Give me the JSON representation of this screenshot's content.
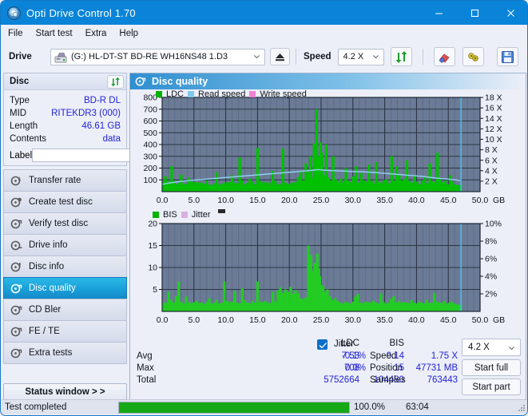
{
  "window": {
    "title": "Opti Drive Control 1.70",
    "icon": "disc-icon",
    "minimize": "minimize-icon",
    "maximize": "maximize-icon",
    "close": "close-icon"
  },
  "menu": {
    "items": [
      "File",
      "Start test",
      "Extra",
      "Help"
    ]
  },
  "toolbar": {
    "drive_label": "Drive",
    "drive_value": "(G:)  HL-DT-ST BD-RE  WH16NS48 1.D3",
    "eject_icon": "eject-icon",
    "speed_label": "Speed",
    "speed_value": "4.2 X",
    "refresh_icon": "refresh-icon",
    "eraser_icon": "eraser-icon",
    "settings_icon": "gear-icon",
    "save_icon": "save-icon"
  },
  "disc": {
    "header": "Disc",
    "refresh_icon": "refresh-icon",
    "rows": [
      {
        "key": "Type",
        "value": "BD-R DL"
      },
      {
        "key": "MID",
        "value": "RITEKDR3 (000)"
      },
      {
        "key": "Length",
        "value": "46.61 GB"
      },
      {
        "key": "Contents",
        "value": "data"
      }
    ],
    "label_key": "Label",
    "label_value": "",
    "label_placeholder": "",
    "cd_icon": "cd-icon"
  },
  "nav": {
    "items": [
      {
        "label": "Transfer rate",
        "icon": "disc-rate-icon",
        "selected": false
      },
      {
        "label": "Create test disc",
        "icon": "disc-create-icon",
        "selected": false
      },
      {
        "label": "Verify test disc",
        "icon": "disc-verify-icon",
        "selected": false
      },
      {
        "label": "Drive info",
        "icon": "disc-drive-icon",
        "selected": false
      },
      {
        "label": "Disc info",
        "icon": "disc-info-icon",
        "selected": false
      },
      {
        "label": "Disc quality",
        "icon": "disc-quality-icon",
        "selected": true
      },
      {
        "label": "CD Bler",
        "icon": "disc-bler-icon",
        "selected": false
      },
      {
        "label": "FE / TE",
        "icon": "disc-fete-icon",
        "selected": false
      },
      {
        "label": "Extra tests",
        "icon": "disc-extra-icon",
        "selected": false
      }
    ],
    "status_window": "Status window > >"
  },
  "panel": {
    "title": "Disc quality",
    "icon": "disc-quality-icon"
  },
  "chart_data": [
    {
      "type": "area",
      "name": "ldc-chart",
      "title": "",
      "xlabel": "GB",
      "ylabel": "",
      "xlim": [
        0,
        50
      ],
      "ylim": [
        0,
        800
      ],
      "y2lim": [
        0,
        18
      ],
      "xticks": [
        "0.0",
        "5.0",
        "10.0",
        "15.0",
        "20.0",
        "25.0",
        "30.0",
        "35.0",
        "40.0",
        "45.0",
        "50.0"
      ],
      "yticks": [
        "100",
        "200",
        "300",
        "400",
        "500",
        "600",
        "700",
        "800"
      ],
      "y2ticks": [
        "2 X",
        "4 X",
        "6 X",
        "8 X",
        "10 X",
        "12 X",
        "14 X",
        "16 X",
        "18 X"
      ],
      "x_unit": "GB",
      "grid": true,
      "legend": [
        {
          "label": "LDC",
          "color": "#00b300"
        },
        {
          "label": "Read speed",
          "color": "#7ec8ef"
        },
        {
          "label": "Write speed",
          "color": "#ee82d6"
        }
      ],
      "series": [
        {
          "name": "LDC",
          "color": "#00c000",
          "kind": "spikes",
          "x": [
            0.2,
            0.5,
            0.8,
            1.1,
            1.5,
            1.9,
            2.2,
            2.6,
            3.0,
            3.4,
            3.8,
            4.2,
            4.6,
            5.0,
            5.4,
            5.8,
            6.2,
            6.6,
            7.0,
            7.4,
            7.8,
            8.2,
            8.6,
            9.0,
            9.4,
            9.8,
            10.2,
            10.6,
            11.0,
            11.4,
            11.8,
            12.2,
            12.6,
            13.0,
            13.4,
            13.8,
            14.2,
            14.6,
            15.0,
            15.4,
            15.8,
            16.2,
            16.6,
            17.0,
            17.4,
            17.8,
            18.2,
            18.6,
            19.0,
            19.4,
            19.8,
            20.2,
            20.6,
            21.0,
            21.4,
            21.8,
            22.2,
            22.6,
            23.0,
            23.3,
            23.6,
            23.9,
            24.1,
            24.3,
            24.5,
            24.7,
            24.9,
            25.1,
            25.3,
            25.5,
            25.8,
            26.1,
            26.5,
            26.9,
            27.3,
            27.7,
            28.1,
            28.5,
            28.9,
            29.3,
            29.7,
            30.1,
            30.5,
            30.9,
            31.3,
            31.7,
            32.1,
            32.5,
            32.9,
            33.3,
            33.7,
            34.1,
            34.5,
            34.9,
            35.3,
            35.7,
            36.1,
            36.5,
            36.9,
            37.3,
            37.7,
            38.1,
            38.5,
            38.9,
            39.3,
            39.7,
            40.1,
            40.5,
            40.9,
            41.3,
            41.7,
            42.1,
            42.5,
            42.9,
            43.3,
            43.7,
            44.1,
            44.5,
            44.9,
            45.3,
            45.7,
            46.1,
            46.5,
            46.9
          ],
          "y": [
            80,
            130,
            95,
            70,
            215,
            90,
            60,
            75,
            145,
            65,
            60,
            120,
            85,
            55,
            60,
            80,
            60,
            65,
            95,
            60,
            55,
            70,
            165,
            60,
            55,
            65,
            80,
            60,
            140,
            70,
            60,
            290,
            95,
            60,
            75,
            110,
            85,
            60,
            370,
            90,
            60,
            70,
            60,
            55,
            175,
            90,
            60,
            65,
            365,
            75,
            60,
            70,
            80,
            60,
            125,
            170,
            95,
            240,
            160,
            300,
            120,
            410,
            240,
            700,
            300,
            175,
            420,
            330,
            115,
            140,
            400,
            120,
            95,
            300,
            105,
            80,
            110,
            85,
            200,
            95,
            80,
            130,
            215,
            75,
            160,
            95,
            80,
            230,
            95,
            60,
            250,
            85,
            75,
            100,
            105,
            70,
            300,
            90,
            215,
            140,
            95,
            105,
            265,
            90,
            75,
            140,
            85,
            60,
            95,
            120,
            70,
            240,
            90,
            70,
            330,
            105,
            80,
            95,
            60,
            140,
            85,
            60,
            55,
            50
          ]
        },
        {
          "name": "Read speed",
          "color": "#8fd3f5",
          "kind": "line",
          "x": [
            0.0,
            2.0,
            4.0,
            6.0,
            8.0,
            10.0,
            12.0,
            14.0,
            16.0,
            18.0,
            20.0,
            22.0,
            23.8,
            24.5,
            25.5,
            27.0,
            29.0,
            31.0,
            33.0,
            35.0,
            37.0,
            39.0,
            41.0,
            43.0,
            45.0,
            46.5,
            47.0
          ],
          "y_x": [
            1.4,
            1.8,
            2.1,
            2.3,
            2.5,
            2.7,
            2.9,
            3.1,
            3.3,
            3.5,
            3.7,
            3.9,
            4.1,
            4.2,
            4.1,
            4.0,
            3.9,
            3.8,
            3.7,
            3.5,
            3.3,
            3.1,
            2.9,
            2.6,
            2.4,
            2.2,
            2.1
          ]
        }
      ],
      "cursor_x": 47.0,
      "cursor_color": "#4fc3f7"
    },
    {
      "type": "area",
      "name": "bis-chart",
      "title": "",
      "xlabel": "GB",
      "ylabel": "",
      "xlim": [
        0,
        50
      ],
      "ylim": [
        0,
        20
      ],
      "y2lim": [
        0,
        10
      ],
      "xticks": [
        "0.0",
        "5.0",
        "10.0",
        "15.0",
        "20.0",
        "25.0",
        "30.0",
        "35.0",
        "40.0",
        "45.0",
        "50.0"
      ],
      "yticks": [
        "5",
        "10",
        "15",
        "20"
      ],
      "y2ticks": [
        "2%",
        "4%",
        "6%",
        "8%",
        "10%"
      ],
      "x_unit": "GB",
      "grid": true,
      "legend": [
        {
          "label": "BIS",
          "color": "#00b300"
        },
        {
          "label": "Jitter",
          "color": "#d8b0e0"
        }
      ],
      "series": [
        {
          "name": "BIS",
          "color": "#22cc22",
          "kind": "spikes",
          "x": [
            0.2,
            0.6,
            1.0,
            1.4,
            1.8,
            2.2,
            2.6,
            3.0,
            3.4,
            3.8,
            4.2,
            4.6,
            5.0,
            5.4,
            5.8,
            6.2,
            6.6,
            7.0,
            7.4,
            7.8,
            8.2,
            8.6,
            9.0,
            9.4,
            9.8,
            10.2,
            10.6,
            11.0,
            11.4,
            11.8,
            12.2,
            12.6,
            13.0,
            13.4,
            13.8,
            14.2,
            14.6,
            15.0,
            15.4,
            15.8,
            16.2,
            16.6,
            17.0,
            17.4,
            17.8,
            18.2,
            18.6,
            19.0,
            19.4,
            19.8,
            20.2,
            20.6,
            21.0,
            21.4,
            21.8,
            22.2,
            22.6,
            23.0,
            23.4,
            23.7,
            24.0,
            24.2,
            24.4,
            24.6,
            24.8,
            25.0,
            25.3,
            25.6,
            26.0,
            26.4,
            26.8,
            27.2,
            27.6,
            28.0,
            28.4,
            28.8,
            29.2,
            29.6,
            30.0,
            30.4,
            30.8,
            31.2,
            31.6,
            32.0,
            32.4,
            32.8,
            33.2,
            33.6,
            34.0,
            34.4,
            34.8,
            35.2,
            35.6,
            36.0,
            36.4,
            36.8,
            37.2,
            37.6,
            38.0,
            38.4,
            38.8,
            39.2,
            39.6,
            40.0,
            40.4,
            40.8,
            41.2,
            41.6,
            42.0,
            42.4,
            42.8,
            43.2,
            43.6,
            44.0,
            44.4,
            44.8,
            45.2,
            45.6,
            46.0,
            46.4,
            46.8
          ],
          "y": [
            1.7,
            2.0,
            4.5,
            2.6,
            2.0,
            3.5,
            6.8,
            2.2,
            1.8,
            3.4,
            2.1,
            1.8,
            2.0,
            2.4,
            1.8,
            2.0,
            1.7,
            2.2,
            3.0,
            1.8,
            2.0,
            2.6,
            1.8,
            2.0,
            6.8,
            2.4,
            1.8,
            2.2,
            4.6,
            2.0,
            1.8,
            5.2,
            2.6,
            2.0,
            1.8,
            2.4,
            2.0,
            6.8,
            2.2,
            1.8,
            2.4,
            2.0,
            1.8,
            4.4,
            2.2,
            4.8,
            5.5,
            4.2,
            5.0,
            4.4,
            5.6,
            4.0,
            4.8,
            4.2,
            3.0,
            2.8,
            3.2,
            15.0,
            12.8,
            9.2,
            11.0,
            8.4,
            13.2,
            9.8,
            8.0,
            6.0,
            5.8,
            4.4,
            5.0,
            3.4,
            2.6,
            3.0,
            2.4,
            2.0,
            1.8,
            2.2,
            2.0,
            1.8,
            2.2,
            3.4,
            4.0,
            2.0,
            1.8,
            2.2,
            2.0,
            1.8,
            2.4,
            2.0,
            1.8,
            4.1,
            2.2,
            1.8,
            2.0,
            2.8,
            3.4,
            2.0,
            2.4,
            1.8,
            2.2,
            2.0,
            1.8,
            2.6,
            2.0,
            1.8,
            2.2,
            2.0,
            1.8,
            2.6,
            2.0,
            1.8,
            4.2,
            2.2,
            1.8,
            2.0,
            2.4,
            1.8,
            2.0,
            2.2,
            1.8,
            1.6,
            1.5
          ]
        }
      ],
      "cursor_x": 47.0,
      "cursor_color": "#4fc3f7"
    }
  ],
  "stats": {
    "col_headers": [
      "LDC",
      "BIS"
    ],
    "rows": [
      {
        "label": "Avg",
        "ldc": "7.53",
        "bis": "0.14"
      },
      {
        "label": "Max",
        "ldc": "708",
        "bis": "15"
      },
      {
        "label": "Total",
        "ldc": "5752664",
        "bis": "104480"
      }
    ],
    "jitter_label": "Jitter",
    "jitter_checked": true,
    "jitter_values": [
      "-0.1%",
      "0.0%"
    ],
    "speed_label": "Speed",
    "speed_value": "1.75 X",
    "position_label": "Position",
    "position_value": "47731 MB",
    "samples_label": "Samples",
    "samples_value": "763443",
    "speed_select": "4.2 X",
    "start_full": "Start full",
    "start_part": "Start part"
  },
  "statusbar": {
    "message": "Test completed",
    "progress_pct": 100,
    "progress_text": "100.0%",
    "elapsed": "63:04"
  },
  "colors": {
    "accent": "#0a84d8",
    "plot_bg": "#6b7b96",
    "green": "#00c000",
    "value_blue": "#2323d6",
    "cursor": "#4fc3f7"
  }
}
